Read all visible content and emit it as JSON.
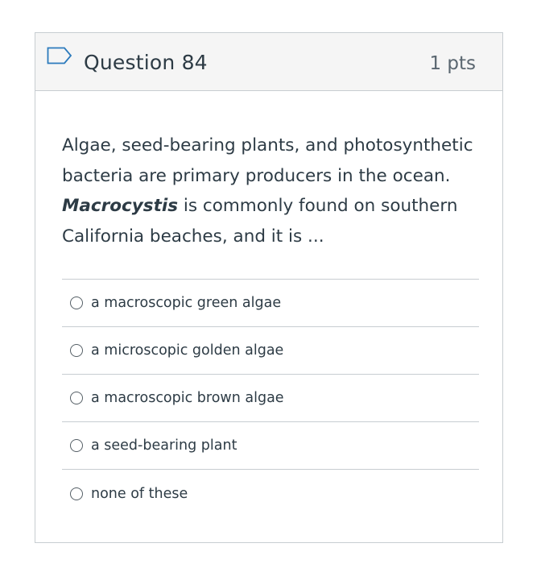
{
  "question": {
    "title": "Question 84",
    "points": "1 pts",
    "text_part1": "Algae, seed-bearing plants, and photosynthetic bacteria are primary producers in the ocean. ",
    "text_emphasis": "Macrocystis",
    "text_part2": " is commonly found on southern California beaches, and it is ...",
    "flag_icon": "flag-outline-icon"
  },
  "answers": [
    {
      "label": "a macroscopic green algae",
      "selected": false
    },
    {
      "label": "a microscopic golden algae",
      "selected": false
    },
    {
      "label": "a macroscopic brown algae",
      "selected": false
    },
    {
      "label": "a seed-bearing plant",
      "selected": false
    },
    {
      "label": "none of these",
      "selected": false
    }
  ],
  "colors": {
    "header_bg": "#f5f5f5",
    "border": "#c7cdd1",
    "flag": "#2b7abc",
    "text": "#2d3b45"
  }
}
